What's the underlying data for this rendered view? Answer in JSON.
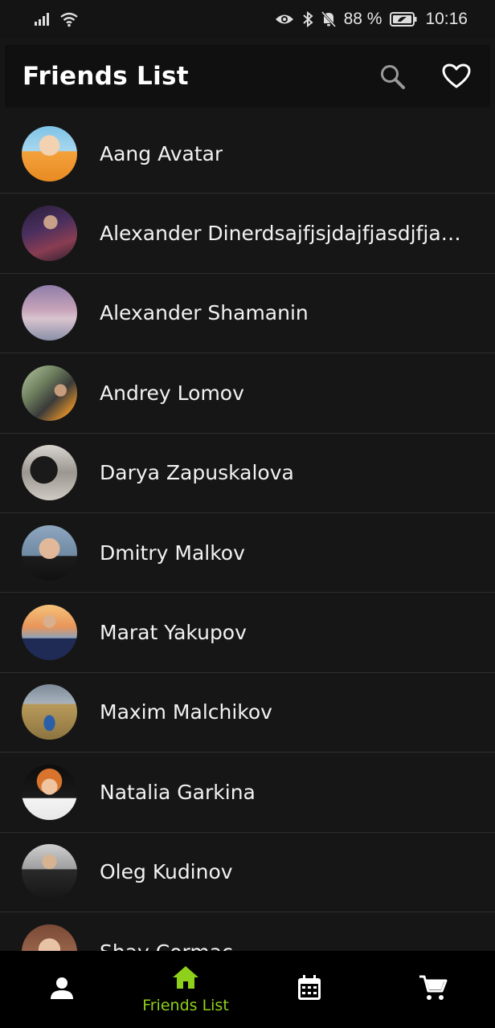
{
  "status_bar": {
    "battery_percent": "88 %",
    "time": "10:16",
    "icons": [
      "signal-icon",
      "wifi-icon",
      "eye-icon",
      "bluetooth-icon",
      "notifications-off-icon",
      "battery-icon"
    ]
  },
  "app_bar": {
    "title": "Friends List",
    "actions": [
      "search-icon",
      "heart-icon"
    ]
  },
  "friends": [
    {
      "name": "Aang Avatar"
    },
    {
      "name": "Alexander Dinerdsajfjsjdajfjasdjfjasj..."
    },
    {
      "name": "Alexander Shamanin"
    },
    {
      "name": "Andrey Lomov"
    },
    {
      "name": "Darya Zapuskalova"
    },
    {
      "name": "Dmitry Malkov"
    },
    {
      "name": "Marat Yakupov"
    },
    {
      "name": "Maxim Malchikov"
    },
    {
      "name": "Natalia Garkina"
    },
    {
      "name": "Oleg Kudinov"
    },
    {
      "name": "Shay Cormac"
    }
  ],
  "bottom_nav": {
    "items": [
      {
        "icon": "person-icon",
        "label": ""
      },
      {
        "icon": "home-icon",
        "label": "Friends List",
        "active": true
      },
      {
        "icon": "calendar-icon",
        "label": ""
      },
      {
        "icon": "cart-icon",
        "label": ""
      }
    ],
    "active_color": "#8fd11a"
  },
  "colors": {
    "background": "#161616",
    "app_bar": "#101010",
    "divider": "#2e2e2e",
    "nav_background": "#000000",
    "accent": "#8fd11a"
  }
}
